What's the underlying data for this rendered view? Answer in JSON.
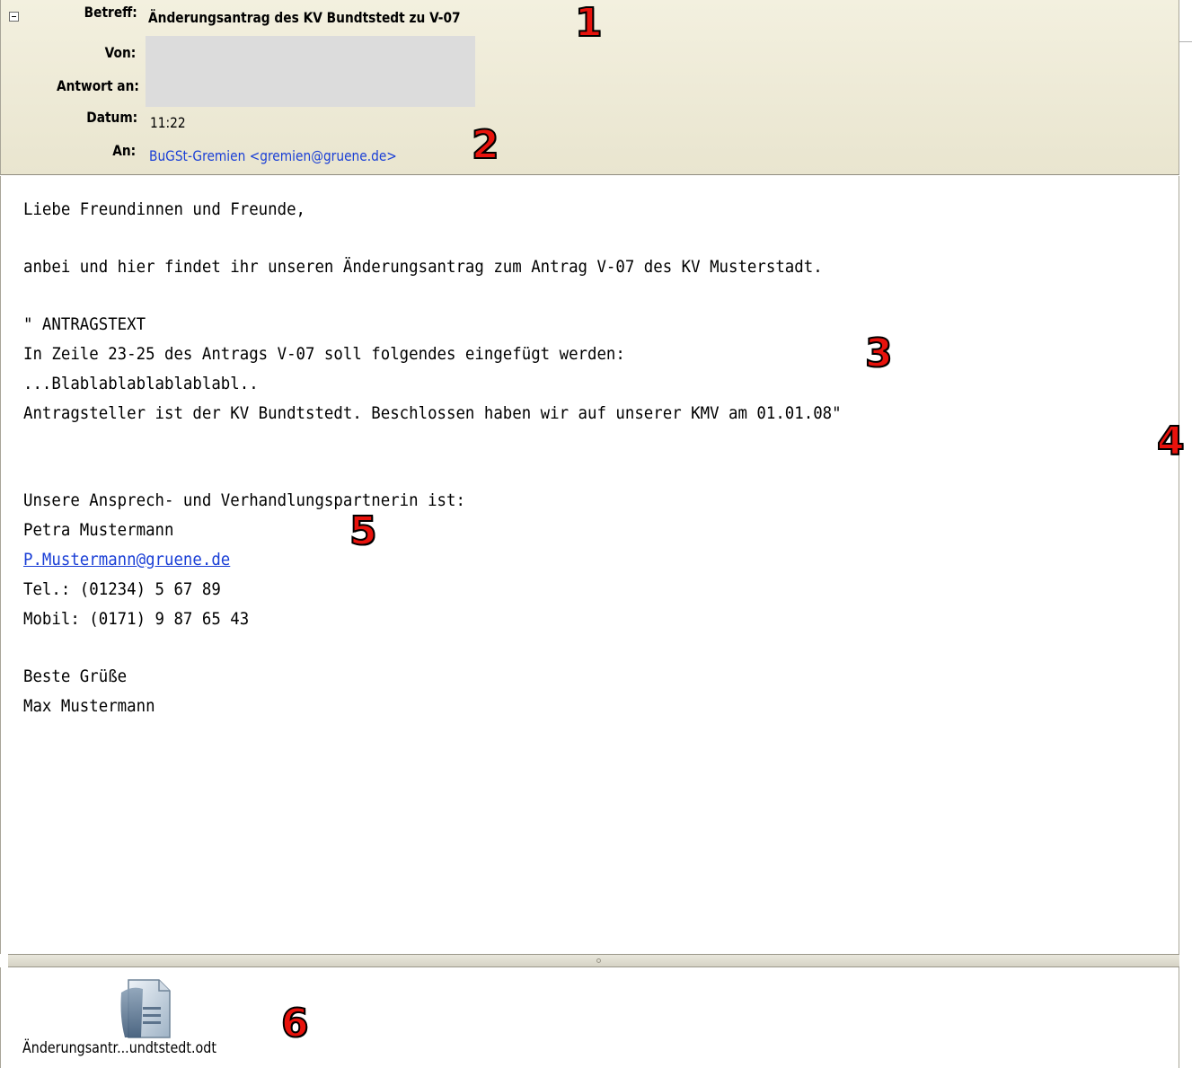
{
  "header": {
    "subject_label": "Betreff:",
    "subject_value": "Änderungsantrag des KV Bundtstedt zu V-07",
    "from_label": "Von:",
    "reply_to_label": "Antwort an:",
    "date_label": "Datum:",
    "date_value": "11:22",
    "to_label": "An:",
    "to_value": "BuGSt-Gremien <gremien@gruene.de>"
  },
  "body": {
    "lines": [
      "Liebe Freundinnen und Freunde,",
      "",
      "anbei und hier findet ihr unseren Änderungsantrag zum Antrag V-07 des KV Musterstadt.",
      "",
      "\" ANTRAGSTEXT",
      "In Zeile 23-25 des Antrags V-07 soll folgendes eingefügt werden:",
      "...Blablablablablablabl..",
      "Antragsteller ist der KV Bundtstedt. Beschlossen haben wir auf unserer KMV am 01.01.08\"",
      "",
      "",
      "Unsere Ansprech- und Verhandlungspartnerin ist:",
      "Petra Mustermann",
      "P.Mustermann@gruene.de",
      "Tel.: (01234) 5 67 89",
      "Mobil: (0171) 9 87 65 43",
      "",
      "Beste Grüße",
      "Max Mustermann"
    ]
  },
  "attachment": {
    "filename": "Änderungsantr...undtstedt.odt",
    "icon": "odt-document-icon"
  },
  "annotations": [
    "1",
    "2",
    "3",
    "4",
    "5",
    "6"
  ],
  "colors": {
    "header_bg": "#efecd9",
    "link": "#1a3fd6",
    "annotation": "#e8120c"
  }
}
